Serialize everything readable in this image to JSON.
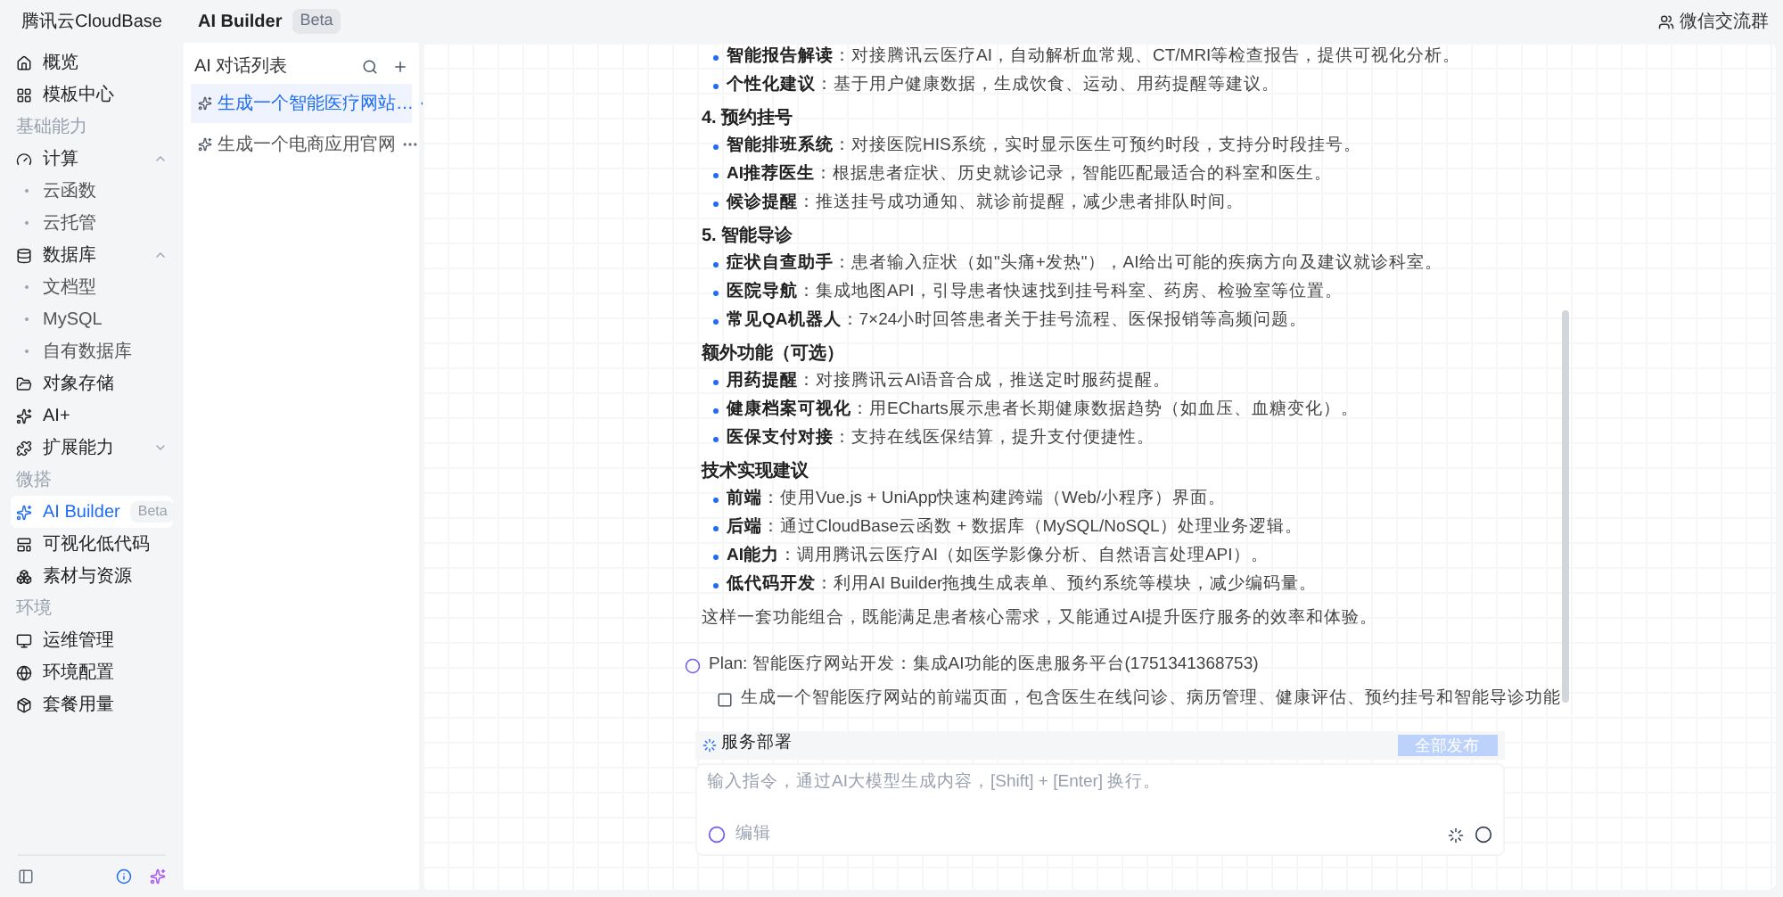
{
  "sidebar": {
    "brand": "腾讯云CloudBase",
    "items": [
      {
        "kind": "item",
        "label": "概览",
        "selected": false
      },
      {
        "kind": "item",
        "label": "模板中心",
        "selected": false
      },
      {
        "kind": "section",
        "label": "基础能力"
      },
      {
        "kind": "item",
        "label": "计算",
        "selected": false,
        "expanded": true
      },
      {
        "kind": "sub",
        "label": "云函数",
        "selected": false
      },
      {
        "kind": "sub",
        "label": "云托管",
        "selected": false
      },
      {
        "kind": "item",
        "label": "数据库",
        "selected": false,
        "expanded": true
      },
      {
        "kind": "sub",
        "label": "文档型",
        "selected": false
      },
      {
        "kind": "sub",
        "label": "MySQL",
        "selected": false
      },
      {
        "kind": "sub",
        "label": "自有数据库",
        "selected": false
      },
      {
        "kind": "item",
        "label": "对象存储",
        "selected": false
      },
      {
        "kind": "item",
        "label": "AI+",
        "selected": false
      },
      {
        "kind": "item",
        "label": "扩展能力",
        "selected": false,
        "expanded": false
      },
      {
        "kind": "section",
        "label": "微搭"
      },
      {
        "kind": "item",
        "label": "AI Builder",
        "badge": "Beta",
        "selected": true
      },
      {
        "kind": "item",
        "label": "可视化低代码",
        "selected": false
      },
      {
        "kind": "item",
        "label": "素材与资源",
        "selected": false
      },
      {
        "kind": "section",
        "label": "环境"
      },
      {
        "kind": "item",
        "label": "运维管理",
        "selected": false
      },
      {
        "kind": "item",
        "label": "环境配置",
        "selected": false
      },
      {
        "kind": "item",
        "label": "套餐用量",
        "selected": false
      }
    ]
  },
  "header": {
    "title": "AI Builder",
    "badge": "Beta",
    "link": "微信交流群"
  },
  "conversations": {
    "title": "AI 对话列表",
    "items": [
      {
        "title": "生成一个智能医疗网站…",
        "selected": true
      },
      {
        "title": "生成一个电商应用官网",
        "selected": false
      }
    ]
  },
  "content": [
    {
      "kind": "bullet",
      "text": "**智能报告解读**：对接腾讯云医疗AI，自动解析血常规、CT/MRI等检查报告，提供可视化分析。"
    },
    {
      "kind": "bullet",
      "text": "**个性化建议**：基于用户健康数据，生成饮食、运动、用药提醒等建议。"
    },
    {
      "kind": "heading",
      "text": "4. 预约挂号"
    },
    {
      "kind": "bullet",
      "text": "**智能排班系统**：对接医院HIS系统，实时显示医生可预约时段，支持分时段挂号。"
    },
    {
      "kind": "bullet",
      "text": "**AI推荐医生**：根据患者症状、历史就诊记录，智能匹配最适合的科室和医生。"
    },
    {
      "kind": "bullet",
      "text": "**候诊提醒**：推送挂号成功通知、就诊前提醒，减少患者排队时间。"
    },
    {
      "kind": "heading",
      "text": "5. 智能导诊"
    },
    {
      "kind": "bullet",
      "text": "**症状自查助手**：患者输入症状（如\"头痛+发热\"），AI给出可能的疾病方向及建议就诊科室。"
    },
    {
      "kind": "bullet",
      "text": "**医院导航**：集成地图API，引导患者快速找到挂号科室、药房、检验室等位置。"
    },
    {
      "kind": "bullet",
      "text": "**常见QA机器人**：7×24小时回答患者关于挂号流程、医保报销等高频问题。"
    },
    {
      "kind": "heading",
      "text": "额外功能（可选）"
    },
    {
      "kind": "bullet",
      "text": "**用药提醒**：对接腾讯云AI语音合成，推送定时服药提醒。"
    },
    {
      "kind": "bullet",
      "text": "**健康档案可视化**：用ECharts展示患者长期健康数据趋势（如血压、血糖变化）。"
    },
    {
      "kind": "bullet",
      "text": "**医保支付对接**：支持在线医保结算，提升支付便捷性。"
    },
    {
      "kind": "heading",
      "text": "技术实现建议"
    },
    {
      "kind": "bullet",
      "text": "**前端**：使用Vue.js + UniApp快速构建跨端（Web/小程序）界面。"
    },
    {
      "kind": "bullet",
      "text": "**后端**：通过CloudBase云函数 + 数据库（MySQL/NoSQL）处理业务逻辑。"
    },
    {
      "kind": "bullet",
      "text": "**AI能力**：调用腾讯云医疗AI（如医学影像分析、自然语言处理API）。"
    },
    {
      "kind": "bullet",
      "text": "**低代码开发**：利用AI Builder拖拽生成表单、预约系统等模块，减少编码量。"
    },
    {
      "kind": "paragraph",
      "text": "这样一套功能组合，既能满足患者核心需求，又能通过AI提升医疗服务的效率和体验。"
    }
  ],
  "plan": {
    "title": "Plan: 智能医疗网站开发：集成AI功能的医患服务平台(1751341368753)",
    "tasks": [
      {
        "label": "生成一个智能医疗网站的前端页面，包含医生在线问诊、病历管理、健康评估、预约挂号和智能导诊功能",
        "checked": false
      }
    ]
  },
  "deploy": {
    "title": "服务部署",
    "button": "全部发布",
    "disabled": true
  },
  "composer": {
    "placeholder": "输入指令，通过AI大模型生成内容，[Shift] + [Enter] 换行。",
    "edit": "编辑"
  }
}
